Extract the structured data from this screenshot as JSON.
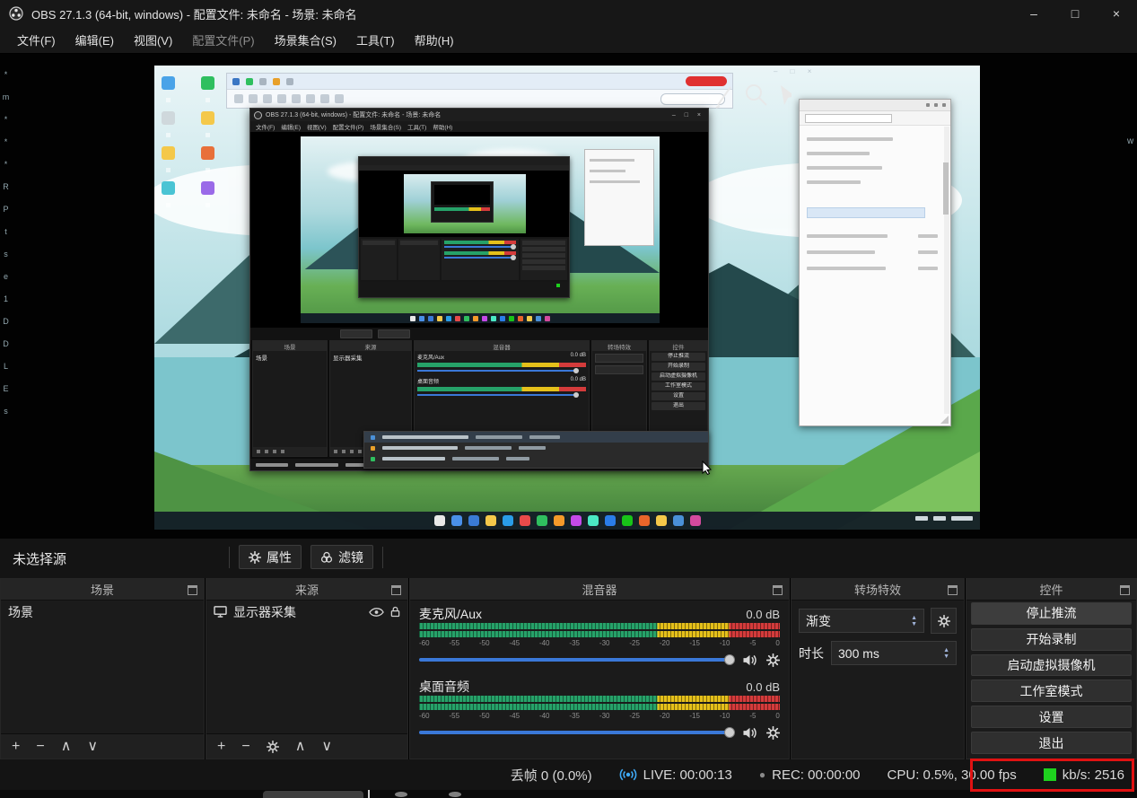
{
  "window": {
    "title": "OBS 27.1.3 (64-bit, windows) - 配置文件: 未命名 - 场景: 未命名",
    "minimize": "–",
    "maximize": "□",
    "close": "×"
  },
  "menu": {
    "items": [
      "文件(F)",
      "编辑(E)",
      "视图(V)",
      "配置文件(P)",
      "场景集合(S)",
      "工具(T)",
      "帮助(H)"
    ]
  },
  "left_edge_chars": [
    "*",
    "m",
    "*",
    "*",
    "*",
    "R",
    "P",
    "t",
    "s",
    "e",
    "1",
    "D",
    "D",
    "L",
    "E",
    "s"
  ],
  "right_edge_char": "w",
  "source_toolbar": {
    "no_source": "未选择源",
    "properties": "属性",
    "filters": "滤镜"
  },
  "panels": {
    "scenes": {
      "title": "场景",
      "items": [
        "场景"
      ]
    },
    "sources": {
      "title": "来源",
      "items": [
        {
          "name": "显示器采集"
        }
      ]
    },
    "mixer": {
      "title": "混音器",
      "channels": [
        {
          "name": "麦克风/Aux",
          "level": "0.0 dB"
        },
        {
          "name": "桌面音频",
          "level": "0.0 dB"
        }
      ],
      "scale": [
        "-60",
        "-55",
        "-50",
        "-45",
        "-40",
        "-35",
        "-30",
        "-25",
        "-20",
        "-15",
        "-10",
        "-5",
        "0"
      ]
    },
    "transitions": {
      "title": "转场特效",
      "selected": "渐变",
      "duration_label": "时长",
      "duration_value": "300 ms"
    },
    "controls": {
      "title": "控件",
      "buttons": [
        "停止推流",
        "开始录制",
        "启动虚拟摄像机",
        "工作室模式",
        "设置",
        "退出"
      ]
    }
  },
  "status_bar": {
    "dropped_frames": "丢帧 0 (0.0%)",
    "live": "LIVE: 00:00:13",
    "rec": "REC: 00:00:00",
    "cpu": "CPU: 0.5%, 30.00 fps",
    "bitrate": "kb/s: 2516"
  },
  "icons": {
    "add": "+",
    "remove": "−",
    "move_up": "∧",
    "move_down": "∨",
    "spin_up": "▲",
    "spin_down": "▼",
    "rec_dot": "●"
  },
  "colors": {
    "accent_blue": "#3a78d8",
    "meter_green": "#26a269",
    "meter_yellow": "#e5c01a",
    "meter_red": "#d43b3b",
    "live_icon": "#3fa9f5",
    "bitrate_green": "#1ed11e",
    "annotation_red": "#e01212"
  },
  "preview": {
    "inner_title": "OBS 27.1.3 (64-bit, windows) - 配置文件: 未命名 - 场景: 未命名",
    "desktop_icon_colors": [
      "#4aa3e8",
      "#2fbf5f",
      "#cfd8dc",
      "#f4c84a",
      "#f4c84a",
      "#e8703a",
      "#4ac4d4",
      "#9a6ae8"
    ],
    "taskbar_icon_colors": [
      "#e8e8e8",
      "#4a90e8",
      "#3a7bd5",
      "#f4c84a",
      "#2a9de8",
      "#e84a4a",
      "#2fbf5f",
      "#f49a2a",
      "#c44ae8",
      "#4ae8c4",
      "#2a7de8",
      "#18c418",
      "#e8652a",
      "#f4c84a",
      "#4a90d8",
      "#d44a9e"
    ]
  }
}
